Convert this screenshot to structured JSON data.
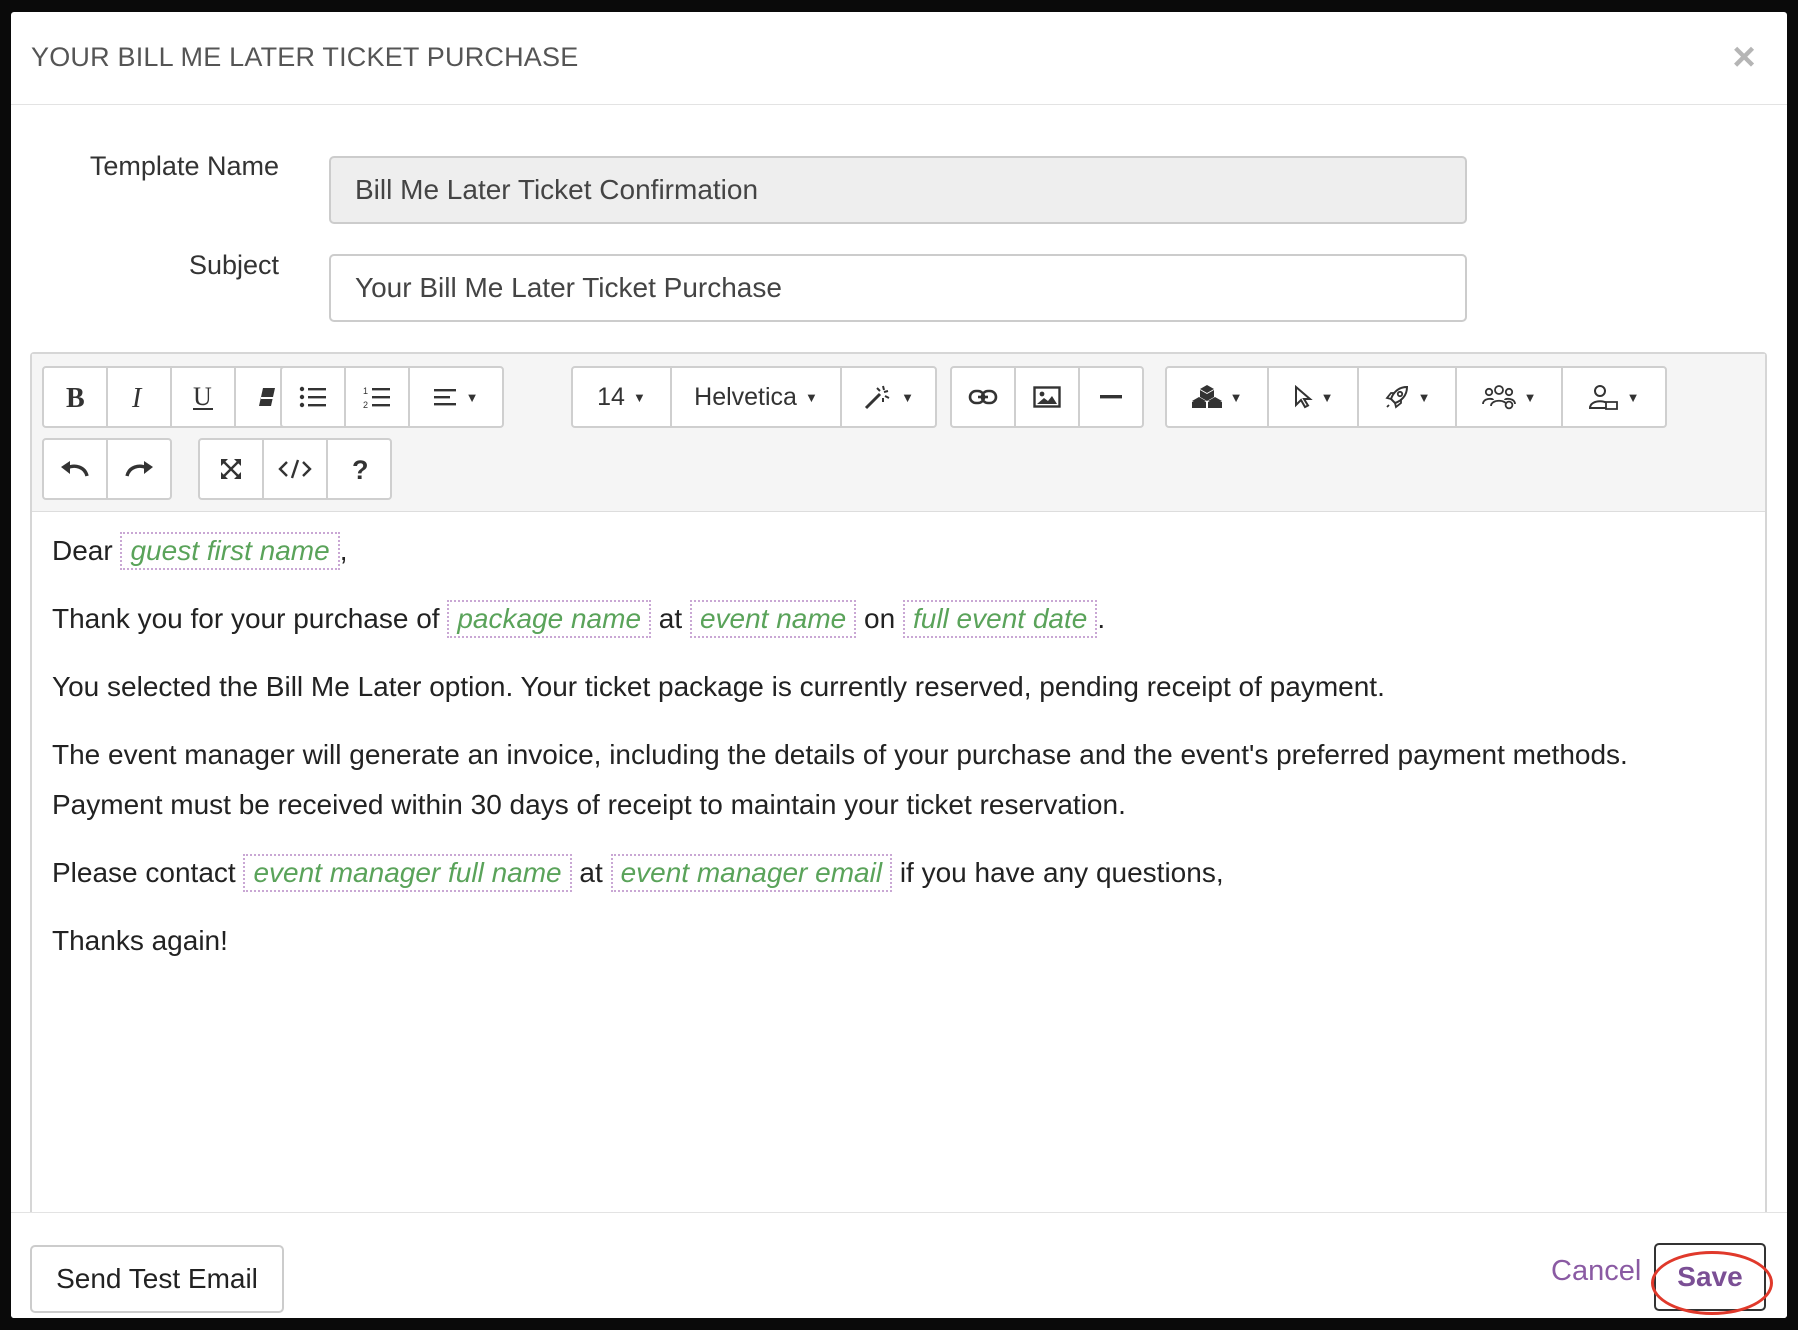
{
  "modal": {
    "title": "YOUR BILL ME LATER TICKET PURCHASE",
    "close_glyph": "×"
  },
  "form": {
    "template_name_label": "Template Name",
    "template_name_value": "Bill Me Later Ticket Confirmation",
    "subject_label": "Subject",
    "subject_value": "Your Bill Me Later Ticket Purchase"
  },
  "toolbar": {
    "font_size": "14",
    "font_family": "Helvetica",
    "icons": [
      "bold-icon",
      "italic-icon",
      "underline-icon",
      "eraser-icon",
      "bullet-list-icon",
      "numbered-list-icon",
      "align-icon",
      "magic-wand-icon",
      "link-icon",
      "image-icon",
      "horizontal-rule-icon",
      "blocks-icon",
      "cursor-icon",
      "rocket-icon",
      "group-icon",
      "user-icon",
      "undo-icon",
      "redo-icon",
      "fullscreen-icon",
      "code-view-icon",
      "help-icon"
    ]
  },
  "body": {
    "line1": {
      "prefix": "Dear",
      "token": "guest first name",
      "suffix": ","
    },
    "line2": {
      "t1": "Thank you for your purchase of",
      "token1": "package name",
      "t2": "at",
      "token2": "event name",
      "t3": "on",
      "token3": "full event date",
      "t4": "."
    },
    "line3": "You selected the Bill Me Later option. Your ticket package is currently reserved, pending receipt of payment.",
    "line4a": "The event manager will generate an invoice, including the details of your purchase and the event's preferred payment methods.",
    "line4b": "Payment must be received within 30 days of receipt to maintain your ticket reservation.",
    "line5": {
      "t1": "Please contact",
      "token1": "event manager full name",
      "t2": "at",
      "token2": "event manager email",
      "t3": "if you have any questions,"
    },
    "line6": "Thanks again!"
  },
  "footer": {
    "send_test_label": "Send Test Email",
    "cancel_label": "Cancel",
    "save_label": "Save"
  },
  "colors": {
    "accent_purple": "#7b4f95",
    "merge_tag_green": "#5aa35a",
    "highlight_red": "#e0392b"
  }
}
